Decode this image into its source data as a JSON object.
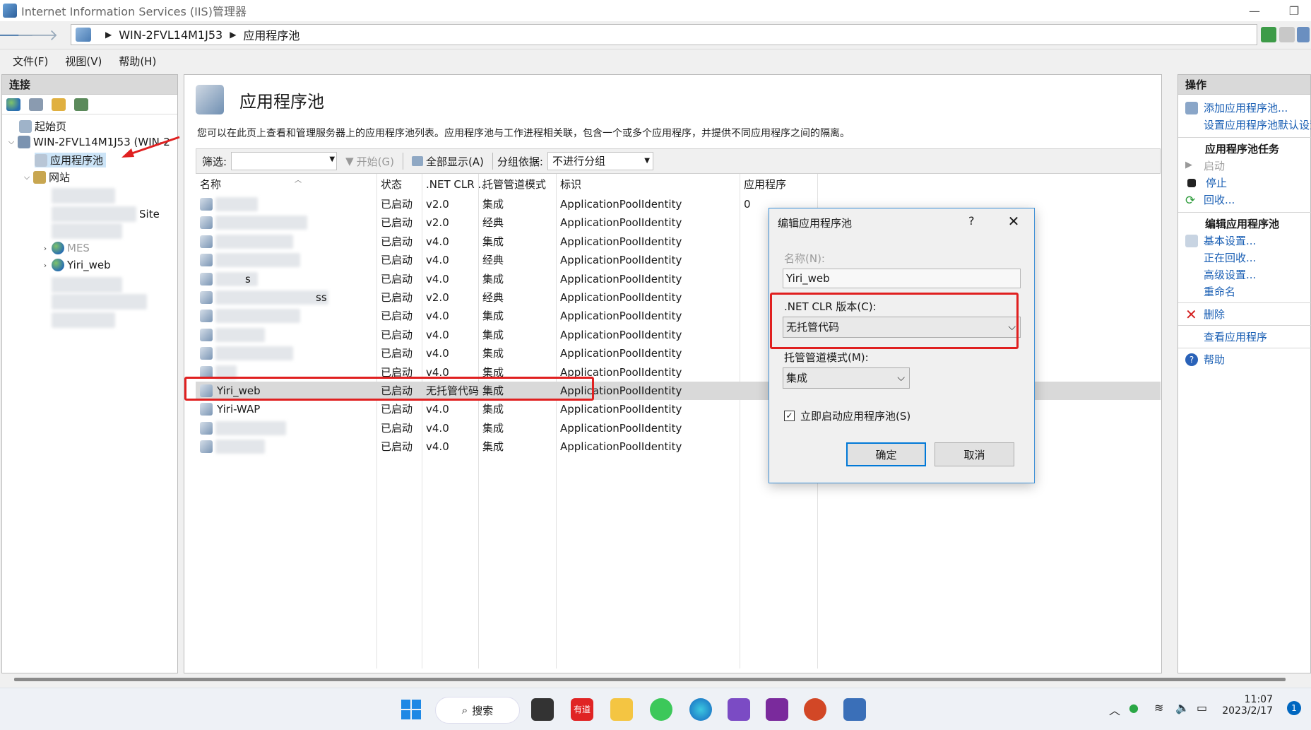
{
  "window": {
    "title": "Internet Information Services (IIS)管理器"
  },
  "address": {
    "crumbs": [
      "WIN-2FVL14M1J53",
      "应用程序池"
    ]
  },
  "menu": [
    "文件(F)",
    "视图(V)",
    "帮助(H)"
  ],
  "connections": {
    "header": "连接",
    "tree": {
      "start_page": "起始页",
      "server": "WIN-2FVL14M1J53 (WIN-2",
      "app_pools": "应用程序池",
      "sites": "网站",
      "site_partial": "Site",
      "site_partial2": "MES",
      "site_yiri_web": "Yiri_web"
    }
  },
  "center": {
    "title": "应用程序池",
    "description": "您可以在此页上查看和管理服务器上的应用程序池列表。应用程序池与工作进程相关联，包含一个或多个应用程序，并提供不同应用程序之间的隔离。",
    "filter": {
      "label": "筛选:",
      "start": "开始(G)",
      "show_all": "全部显示(A)",
      "group_by": "分组依据:",
      "group_value": "不进行分组"
    },
    "columns": [
      "名称",
      "状态",
      ".NET CLR ...",
      "托管管道模式",
      "标识",
      "应用程序"
    ],
    "rows": [
      {
        "name": "",
        "status": "已启动",
        "clr": "v2.0",
        "mode": "集成",
        "identity": "ApplicationPoolIdentity",
        "apps": "0"
      },
      {
        "name": "",
        "status": "已启动",
        "clr": "v2.0",
        "mode": "经典",
        "identity": "ApplicationPoolIdentity",
        "apps": ""
      },
      {
        "name": "",
        "status": "已启动",
        "clr": "v4.0",
        "mode": "集成",
        "identity": "ApplicationPoolIdentity",
        "apps": ""
      },
      {
        "name": "",
        "status": "已启动",
        "clr": "v4.0",
        "mode": "经典",
        "identity": "ApplicationPoolIdentity",
        "apps": ""
      },
      {
        "name": "s",
        "status": "已启动",
        "clr": "v4.0",
        "mode": "集成",
        "identity": "ApplicationPoolIdentity",
        "apps": ""
      },
      {
        "name": "ss",
        "status": "已启动",
        "clr": "v2.0",
        "mode": "经典",
        "identity": "ApplicationPoolIdentity",
        "apps": ""
      },
      {
        "name": "",
        "status": "已启动",
        "clr": "v4.0",
        "mode": "集成",
        "identity": "ApplicationPoolIdentity",
        "apps": ""
      },
      {
        "name": "",
        "status": "已启动",
        "clr": "v4.0",
        "mode": "集成",
        "identity": "ApplicationPoolIdentity",
        "apps": ""
      },
      {
        "name": "",
        "status": "已启动",
        "clr": "v4.0",
        "mode": "集成",
        "identity": "ApplicationPoolIdentity",
        "apps": ""
      },
      {
        "name": "",
        "status": "已启动",
        "clr": "v4.0",
        "mode": "集成",
        "identity": "ApplicationPoolIdentity",
        "apps": ""
      },
      {
        "name": "Yiri_web",
        "status": "已启动",
        "clr": "无托管代码",
        "mode": "集成",
        "identity": "ApplicationPoolIdentity",
        "apps": ""
      },
      {
        "name": "Yiri-WAP",
        "status": "已启动",
        "clr": "v4.0",
        "mode": "集成",
        "identity": "ApplicationPoolIdentity",
        "apps": ""
      },
      {
        "name": "",
        "status": "已启动",
        "clr": "v4.0",
        "mode": "集成",
        "identity": "ApplicationPoolIdentity",
        "apps": ""
      },
      {
        "name": "",
        "status": "已启动",
        "clr": "v4.0",
        "mode": "集成",
        "identity": "ApplicationPoolIdentity",
        "apps": ""
      }
    ]
  },
  "actions": {
    "header": "操作",
    "add_pool": "添加应用程序池...",
    "set_defaults": "设置应用程序池默认设置...",
    "tasks_header": "应用程序池任务",
    "start": "启动",
    "stop": "停止",
    "recycle": "回收...",
    "edit_header": "编辑应用程序池",
    "basic_settings": "基本设置...",
    "recycling": "正在回收...",
    "advanced": "高级设置...",
    "rename": "重命名",
    "delete": "删除",
    "view_apps": "查看应用程序",
    "help": "帮助"
  },
  "dialog": {
    "title": "编辑应用程序池",
    "help": "?",
    "name_label": "名称(N):",
    "name_value": "Yiri_web",
    "clr_label": ".NET CLR 版本(C):",
    "clr_value": "无托管代码",
    "mode_label": "托管管道模式(M):",
    "mode_value": "集成",
    "autostart_label": "立即启动应用程序池(S)",
    "ok": "确定",
    "cancel": "取消"
  },
  "taskbar": {
    "search": "搜索",
    "youdao": "有道",
    "time": "11:07",
    "date": "2023/2/17",
    "notifications": "1"
  },
  "colors": {
    "link": "#1a5fb4",
    "annotation": "#e02020",
    "dialog_border": "#3c8fd6",
    "selected_row": "#d9d9d9"
  }
}
